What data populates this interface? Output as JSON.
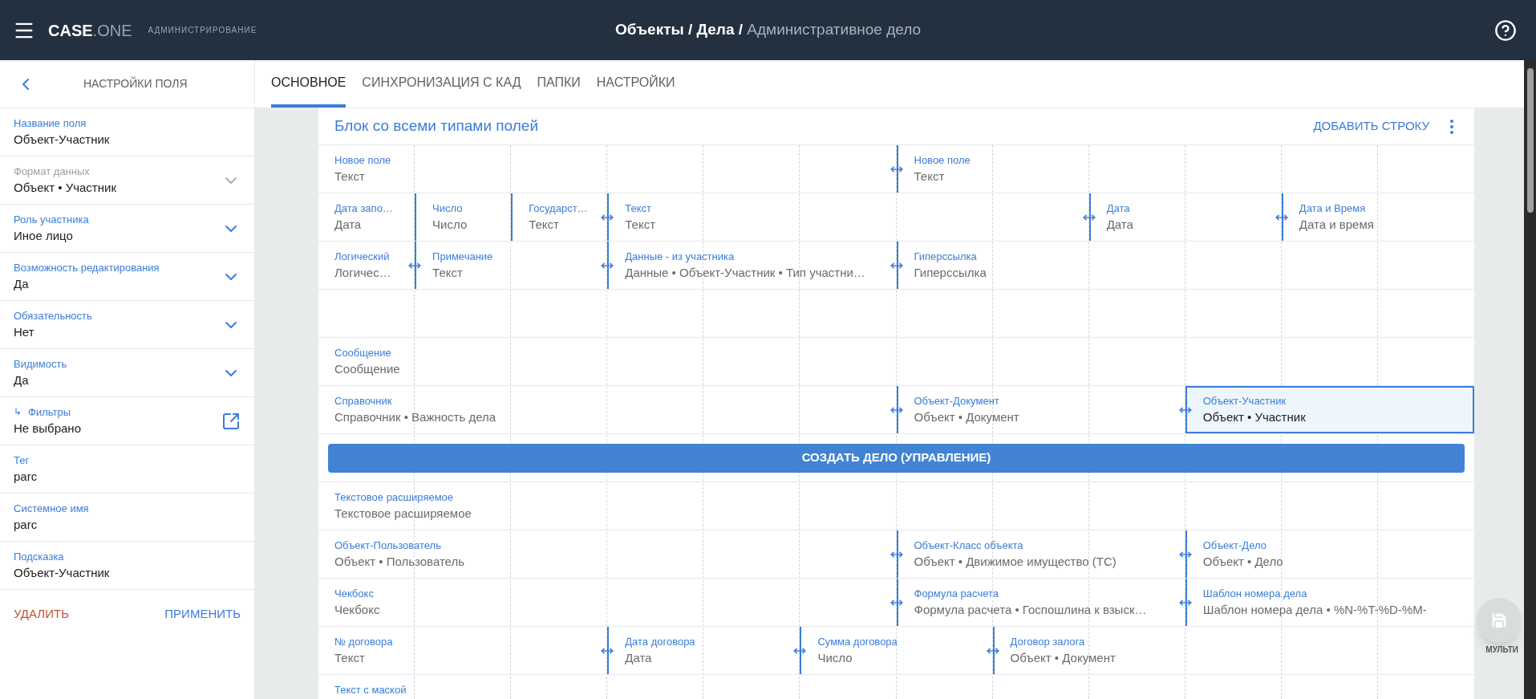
{
  "header": {
    "logo_main": "CASE",
    "logo_suffix": ".ONE",
    "section": "АДМИНИСТРИРОВАНИЕ",
    "breadcrumb_separator": "/",
    "breadcrumb": [
      "Объекты",
      "Дела",
      "Административное дело"
    ]
  },
  "sidebar": {
    "title": "НАСТРОЙКИ ПОЛЯ",
    "fields": [
      {
        "kind": "text",
        "label": "Название поля",
        "value": "Объект-Участник",
        "disabled": false
      },
      {
        "kind": "select",
        "label": "Формат данных",
        "value": "Объект • Участник",
        "disabled": true
      },
      {
        "kind": "select",
        "label": "Роль участника",
        "value": "Иное лицо",
        "disabled": false
      },
      {
        "kind": "select",
        "label": "Возможность редактирования",
        "value": "Да",
        "disabled": false
      },
      {
        "kind": "select",
        "label": "Обязательность",
        "value": "Нет",
        "disabled": false
      },
      {
        "kind": "select",
        "label": "Видимость",
        "value": "Да",
        "disabled": false
      },
      {
        "kind": "link",
        "prefix": "↳",
        "label": "Фильтры",
        "value": "Не выбрано",
        "disabled": false
      },
      {
        "kind": "text",
        "label": "Тег",
        "value": "parc",
        "disabled": false
      },
      {
        "kind": "text",
        "label": "Системное имя",
        "value": "parc",
        "disabled": false
      },
      {
        "kind": "text",
        "label": "Подсказка",
        "value": "Объект-Участник",
        "disabled": false
      }
    ],
    "buttons": [
      {
        "label": "УДАЛИТЬ",
        "kind": "danger"
      },
      {
        "label": "ПРИМЕНИТЬ",
        "kind": "primary"
      }
    ]
  },
  "tabs": [
    {
      "label": "ОСНОВНОЕ",
      "selected": true
    },
    {
      "label": "СИНХРОНИЗАЦИЯ С КАД",
      "selected": false
    },
    {
      "label": "ПАПКИ",
      "selected": false
    },
    {
      "label": "НАСТРОЙКИ",
      "selected": false
    }
  ],
  "block": {
    "title": "Блок со всеми типами полей",
    "add_row": "ДОБАВИТЬ СТРОКУ",
    "rows": [
      {
        "kind": "fields",
        "cells": [
          {
            "kind": "plain",
            "label": "Новое поле",
            "value": "Текст",
            "selected": false
          },
          {
            "kind": "resizable",
            "label": "Новое поле",
            "value": "Текст",
            "selected": false
          }
        ]
      },
      {
        "kind": "fields",
        "cells": [
          {
            "kind": "plain",
            "label": "Дата запо…",
            "value": "Дата",
            "selected": false
          },
          {
            "kind": "divided",
            "label": "Число",
            "value": "Число",
            "selected": false
          },
          {
            "kind": "divided",
            "label": "Государст…",
            "value": "Текст",
            "selected": false
          },
          {
            "kind": "resizable",
            "label": "Текст",
            "value": "Текст",
            "selected": false
          },
          {
            "kind": "resizable",
            "label": "Дата",
            "value": "Дата",
            "selected": false
          },
          {
            "kind": "resizable",
            "label": "Дата и Время",
            "value": "Дата и время",
            "selected": false
          }
        ]
      },
      {
        "kind": "fields",
        "cells": [
          {
            "kind": "plain",
            "label": "Логический",
            "value": "Логичес…",
            "selected": false
          },
          {
            "kind": "resizable",
            "label": "Примечание",
            "value": "Текст",
            "selected": false
          },
          {
            "kind": "resizable",
            "label": "Данные - из участника",
            "value": "Данные • Объект-Участник • Тип участни…",
            "selected": false
          },
          {
            "kind": "resizable",
            "label": "Гиперссылка",
            "value": "Гиперссылка",
            "selected": false
          }
        ]
      },
      {
        "kind": "empty"
      },
      {
        "kind": "fields",
        "cells": [
          {
            "kind": "plain",
            "label": "Сообщение",
            "value": "Сообщение",
            "selected": false
          }
        ]
      },
      {
        "kind": "fields",
        "cells": [
          {
            "kind": "plain",
            "label": "Справочник",
            "value": "Справочник • Важность дела",
            "selected": false
          },
          {
            "kind": "resizable",
            "label": "Объект-Документ",
            "value": "Объект • Документ",
            "selected": false
          },
          {
            "kind": "resizable",
            "label": "Объект-Участник",
            "value": "Объект • Участник",
            "selected": true
          }
        ]
      },
      {
        "kind": "button",
        "label": "СОЗДАТЬ ДЕЛО (УПРАВЛЕНИЕ)"
      },
      {
        "kind": "fields",
        "cells": [
          {
            "kind": "plain",
            "label": "Текстовое расширяемое",
            "value": "Текстовое расширяемое",
            "selected": false
          }
        ]
      },
      {
        "kind": "fields",
        "cells": [
          {
            "kind": "plain",
            "label": "Объект-Пользователь",
            "value": "Объект • Пользователь",
            "selected": false
          },
          {
            "kind": "resizable",
            "label": "Объект-Класс объекта",
            "value": "Объект • Движимое имущество (ТС)",
            "selected": false
          },
          {
            "kind": "resizable",
            "label": "Объект-Дело",
            "value": "Объект • Дело",
            "selected": false
          }
        ]
      },
      {
        "kind": "fields",
        "cells": [
          {
            "kind": "plain",
            "label": "Чекбокс",
            "value": "Чекбокс",
            "selected": false
          },
          {
            "kind": "resizable",
            "label": "Формула расчета",
            "value": "Формула расчета • Госпошлина к взыск…",
            "selected": false
          },
          {
            "kind": "resizable",
            "label": "Шаблон номера дела",
            "value": "Шаблон номера дела • %N-%T-%D-%M-",
            "selected": false
          }
        ]
      },
      {
        "kind": "fields",
        "cells": [
          {
            "kind": "plain",
            "label": "№ договора",
            "value": "Текст",
            "selected": false
          },
          {
            "kind": "resizable",
            "label": "Дата договора",
            "value": "Дата",
            "selected": false
          },
          {
            "kind": "resizable",
            "label": "Сумма договора",
            "value": "Число",
            "selected": false
          },
          {
            "kind": "resizable",
            "label": "Договор залога",
            "value": "Объект • Документ",
            "selected": false
          }
        ]
      },
      {
        "kind": "partial",
        "label": "Текст с маской"
      }
    ]
  },
  "fab": {
    "label": "МУЛЬТИ"
  }
}
